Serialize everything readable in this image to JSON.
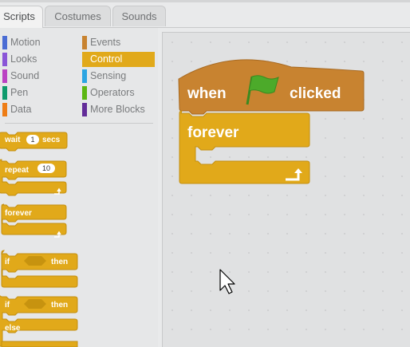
{
  "tabs": [
    {
      "label": "Scripts",
      "active": true
    },
    {
      "label": "Costumes",
      "active": false
    },
    {
      "label": "Sounds",
      "active": false
    }
  ],
  "categories": [
    {
      "label": "Motion",
      "color": "#4a6cd4",
      "selected": false
    },
    {
      "label": "Looks",
      "color": "#8a55d7",
      "selected": false
    },
    {
      "label": "Sound",
      "color": "#bb42c3",
      "selected": false
    },
    {
      "label": "Pen",
      "color": "#0e9a6c",
      "selected": false
    },
    {
      "label": "Data",
      "color": "#ee7d16",
      "selected": false
    },
    {
      "label": "Events",
      "color": "#c88330",
      "selected": false
    },
    {
      "label": "Control",
      "color": "#e1a91a",
      "selected": true
    },
    {
      "label": "Sensing",
      "color": "#2ca5e2",
      "selected": false
    },
    {
      "label": "Operators",
      "color": "#5cb712",
      "selected": false
    },
    {
      "label": "More Blocks",
      "color": "#632d99",
      "selected": false
    }
  ],
  "palette_blocks": {
    "wait": {
      "label": "wait",
      "value": "1",
      "suffix": "secs"
    },
    "repeat": {
      "label": "repeat",
      "value": "10"
    },
    "forever": {
      "label": "forever"
    },
    "if_then": {
      "if": "if",
      "then": "then"
    },
    "if_then_else": {
      "if": "if",
      "then": "then",
      "else": "else"
    }
  },
  "script": {
    "hat": {
      "when": "when",
      "clicked": "clicked",
      "icon": "green-flag-icon"
    },
    "forever": {
      "label": "forever",
      "icon": "loop-arrow-icon"
    }
  },
  "colors": {
    "control": "#e1a91a",
    "events": "#c88330",
    "flag": "#4caa2a"
  },
  "cursor": "mouse-pointer-icon"
}
